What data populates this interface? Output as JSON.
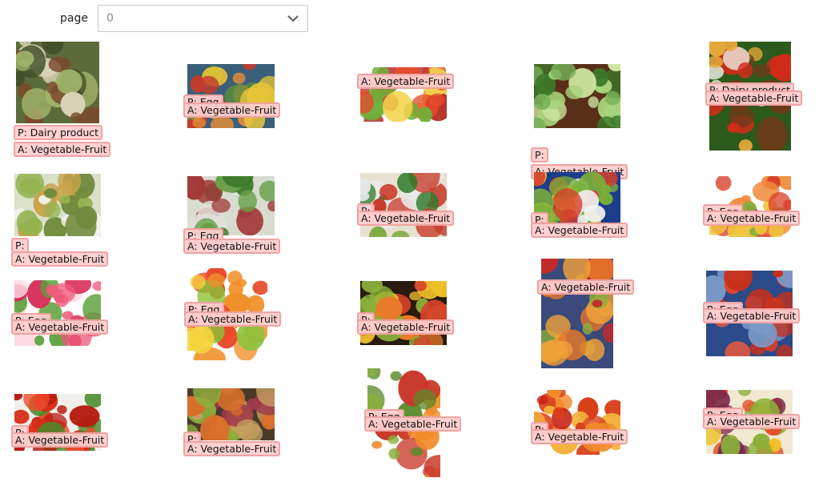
{
  "pager": {
    "label": "page",
    "value": "0"
  },
  "colors": {
    "label_bg": "#ffcdcd",
    "label_border": "#f0a2a2"
  },
  "tiles": [
    {
      "p": "P: Dairy product",
      "a": "A: Vegetable-Fruit"
    },
    {
      "p": "P: Egg",
      "a": "A: Vegetable-Fruit"
    },
    {
      "p": "",
      "a": "A: Vegetable-Fruit"
    },
    {
      "p": "P:",
      "a": "A: Vegetable-Fruit"
    },
    {
      "p": "P: Dairy product",
      "a": "A: Vegetable-Fruit"
    },
    {
      "p": "P:",
      "a": "A: Vegetable-Fruit"
    },
    {
      "p": "P: Egg",
      "a": "A: Vegetable-Fruit"
    },
    {
      "p": "P:",
      "a": "A: Vegetable-Fruit"
    },
    {
      "p": "P:",
      "a": "A: Vegetable-Fruit"
    },
    {
      "p": "P: Egg",
      "a": "A: Vegetable-Fruit"
    },
    {
      "p": "P: Egg",
      "a": "A: Vegetable-Fruit"
    },
    {
      "p": "P: Egg",
      "a": "A: Vegetable-Fruit"
    },
    {
      "p": "P:",
      "a": "A: Vegetable-Fruit"
    },
    {
      "p": "",
      "a": "A: Vegetable-Fruit"
    },
    {
      "p": "P: Egg",
      "a": "A: Vegetable-Fruit"
    },
    {
      "p": "P:",
      "a": "A: Vegetable-Fruit"
    },
    {
      "p": "P:",
      "a": "A: Vegetable-Fruit"
    },
    {
      "p": "P: Egg",
      "a": "A: Vegetable-Fruit"
    },
    {
      "p": "P:",
      "a": "A: Vegetable-Fruit"
    },
    {
      "p": "P: Egg",
      "a": "A: Vegetable-Fruit"
    }
  ]
}
